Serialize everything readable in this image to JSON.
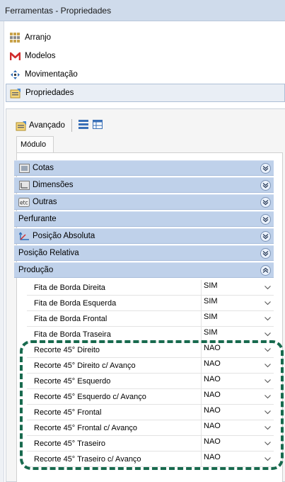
{
  "window": {
    "title": "Ferramentas - Propriedades"
  },
  "nav": [
    {
      "label": "Arranjo",
      "icon": "grid-icon"
    },
    {
      "label": "Modelos",
      "icon": "m-logo-icon"
    },
    {
      "label": "Movimentação",
      "icon": "move-arrows-icon"
    },
    {
      "label": "Propriedades",
      "icon": "properties-icon",
      "active": true
    }
  ],
  "toolbar": {
    "advanced_label": "Avançado"
  },
  "tabs": {
    "modulo": "Módulo"
  },
  "groups": [
    {
      "label": "Cotas",
      "icon": "ruler-icon",
      "expanded": false
    },
    {
      "label": "Dimensões",
      "icon": "dimension-icon",
      "expanded": false
    },
    {
      "label": "Outras",
      "icon": "etc-icon",
      "expanded": false
    },
    {
      "label": "Perfurante",
      "expanded": false
    },
    {
      "label": "Posição Absoluta",
      "icon": "axes-icon",
      "expanded": false
    },
    {
      "label": "Posição Relativa",
      "expanded": false
    },
    {
      "label": "Produção",
      "expanded": true
    }
  ],
  "rows": [
    {
      "label": "Fita de Borda Direita",
      "value": "SIM"
    },
    {
      "label": "Fita de Borda Esquerda",
      "value": "SIM"
    },
    {
      "label": "Fita de Borda Frontal",
      "value": "SIM"
    },
    {
      "label": "Fita de Borda Traseira",
      "value": "SIM"
    },
    {
      "label": "Recorte 45° Direito",
      "value": "NAO"
    },
    {
      "label": "Recorte 45° Direito c/ Avanço",
      "value": "NAO"
    },
    {
      "label": "Recorte 45° Esquerdo",
      "value": "NAO"
    },
    {
      "label": "Recorte 45° Esquerdo c/ Avanço",
      "value": "NAO"
    },
    {
      "label": "Recorte 45° Frontal",
      "value": "NAO"
    },
    {
      "label": "Recorte 45° Frontal c/ Avanço",
      "value": "NAO"
    },
    {
      "label": "Recorte 45° Traseiro",
      "value": "NAO"
    },
    {
      "label": "Recorte 45° Traseiro c/ Avanço",
      "value": "NAO"
    }
  ],
  "colors": {
    "highlight_dash": "#186a4e",
    "group_header": "#bfd1ea",
    "title_bar": "#cfdbeb"
  }
}
